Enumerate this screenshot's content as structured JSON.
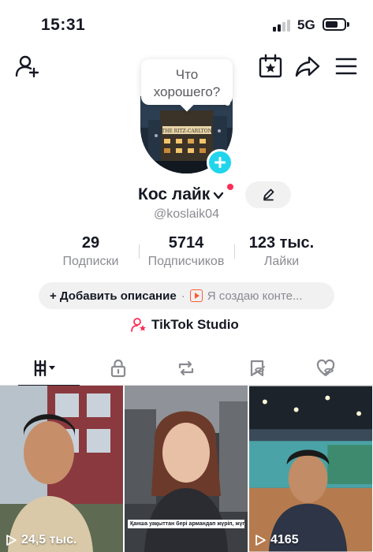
{
  "status_bar": {
    "time": "15:31",
    "network": "5G"
  },
  "header": {
    "add_friend_icon": "person-plus-icon",
    "calendar_icon": "calendar-star-icon",
    "share_icon": "share-arrow-icon",
    "menu_icon": "hamburger-menu-icon"
  },
  "tooltip": {
    "line1": "Что",
    "line2": "хорошего?"
  },
  "profile": {
    "display_name": "Кос лайк",
    "username": "@koslaik04"
  },
  "stats": [
    {
      "value": "29",
      "label": "Подписки"
    },
    {
      "value": "5714",
      "label": "Подписчиков"
    },
    {
      "value": "123 тыс.",
      "label": "Лайки"
    }
  ],
  "bio": {
    "add_label": "+ Добавить описание",
    "separator": "·",
    "creator_label": "Я создаю конте..."
  },
  "studio": {
    "label": "TikTok Studio"
  },
  "videos": [
    {
      "views": "24,5 тыс.",
      "caption": ""
    },
    {
      "views": "",
      "caption": "Қанша уақыттан бері армандап жүріп, жүгіріп жүріп"
    },
    {
      "views": "4165",
      "caption": ""
    }
  ],
  "colors": {
    "accent_cyan": "#20d5ec",
    "accent_red": "#fe2c55",
    "text_primary": "#161823",
    "text_secondary": "#8a8b91"
  }
}
